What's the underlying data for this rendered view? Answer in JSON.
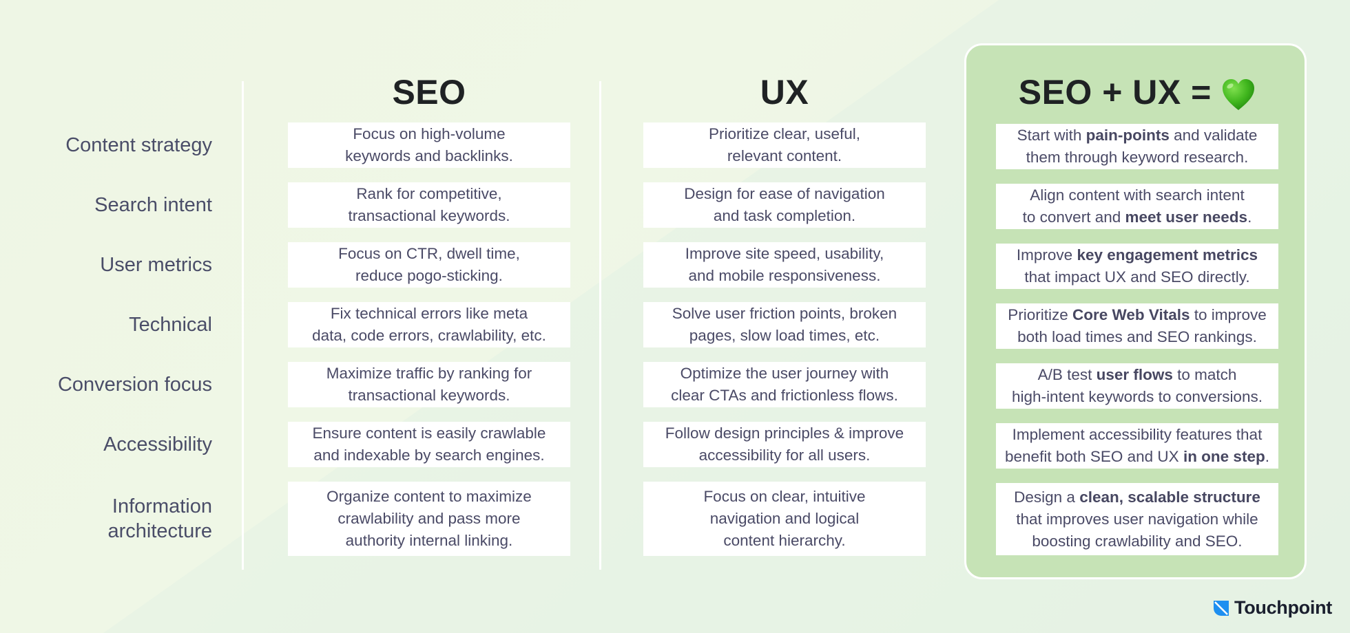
{
  "columns": {
    "seo": "SEO",
    "ux": "UX",
    "combined": "SEO + UX =",
    "combined_icon": "green-heart-icon"
  },
  "rows": [
    {
      "label": "Content strategy",
      "seo": [
        "Focus on high-volume",
        "keywords and backlinks."
      ],
      "ux": [
        "Prioritize clear, useful,",
        "relevant content."
      ],
      "combined": [
        [
          {
            "t": "Start with ",
            "b": false
          },
          {
            "t": "pain-points",
            "b": true
          },
          {
            "t": " and validate",
            "b": false
          }
        ],
        [
          {
            "t": "them through keyword research.",
            "b": false
          }
        ]
      ]
    },
    {
      "label": "Search intent",
      "seo": [
        "Rank for competitive,",
        "transactional keywords."
      ],
      "ux": [
        "Design for ease of navigation",
        "and task completion."
      ],
      "combined": [
        [
          {
            "t": "Align content with search intent",
            "b": false
          }
        ],
        [
          {
            "t": "to convert and ",
            "b": false
          },
          {
            "t": "meet user needs",
            "b": true
          },
          {
            "t": ".",
            "b": false
          }
        ]
      ]
    },
    {
      "label": "User metrics",
      "seo": [
        "Focus on CTR, dwell time,",
        "reduce pogo-sticking."
      ],
      "ux": [
        "Improve site speed, usability,",
        "and mobile responsiveness."
      ],
      "combined": [
        [
          {
            "t": "Improve ",
            "b": false
          },
          {
            "t": "key engagement metrics",
            "b": true
          }
        ],
        [
          {
            "t": "that impact UX and SEO directly.",
            "b": false
          }
        ]
      ]
    },
    {
      "label": "Technical",
      "seo": [
        "Fix technical errors like meta",
        "data, code errors, crawlability, etc."
      ],
      "ux": [
        "Solve user friction points, broken",
        "pages, slow load times, etc."
      ],
      "combined": [
        [
          {
            "t": "Prioritize ",
            "b": false
          },
          {
            "t": "Core Web Vitals",
            "b": true
          },
          {
            "t": " to improve",
            "b": false
          }
        ],
        [
          {
            "t": "both load times and SEO rankings.",
            "b": false
          }
        ]
      ]
    },
    {
      "label": "Conversion focus",
      "seo": [
        "Maximize traffic by ranking for",
        "transactional keywords."
      ],
      "ux": [
        "Optimize the user journey with",
        "clear CTAs and frictionless flows."
      ],
      "combined": [
        [
          {
            "t": "A/B test ",
            "b": false
          },
          {
            "t": "user flows",
            "b": true
          },
          {
            "t": " to match",
            "b": false
          }
        ],
        [
          {
            "t": "high-intent keywords to conversions.",
            "b": false
          }
        ]
      ]
    },
    {
      "label": "Accessibility",
      "seo": [
        "Ensure content is easily crawlable",
        "and indexable by search engines."
      ],
      "ux": [
        "Follow design principles & improve",
        "accessibility for all users."
      ],
      "combined": [
        [
          {
            "t": "Implement accessibility features that",
            "b": false
          }
        ],
        [
          {
            "t": "benefit both SEO and UX ",
            "b": false
          },
          {
            "t": "in one step",
            "b": true
          },
          {
            "t": ".",
            "b": false
          }
        ]
      ]
    },
    {
      "label": "Information architecture",
      "label_lines": [
        "Information",
        "architecture"
      ],
      "seo": [
        "Organize content to maximize",
        "crawlability and pass more",
        "authority internal linking."
      ],
      "ux": [
        "Focus on clear, intuitive",
        "navigation and logical",
        "content hierarchy."
      ],
      "combined": [
        [
          {
            "t": "Design a ",
            "b": false
          },
          {
            "t": "clean, scalable structure",
            "b": true
          }
        ],
        [
          {
            "t": "that improves user navigation while",
            "b": false
          }
        ],
        [
          {
            "t": "boosting crawlability and SEO.",
            "b": false
          }
        ]
      ]
    }
  ],
  "brand": {
    "name": "Touchpoint",
    "icon": "touchpoint-logo-icon",
    "accent": "#1e8ff0"
  },
  "colors": {
    "panel": "#c6e3b6",
    "text": "#4a4a66",
    "heading": "#1f2224"
  }
}
